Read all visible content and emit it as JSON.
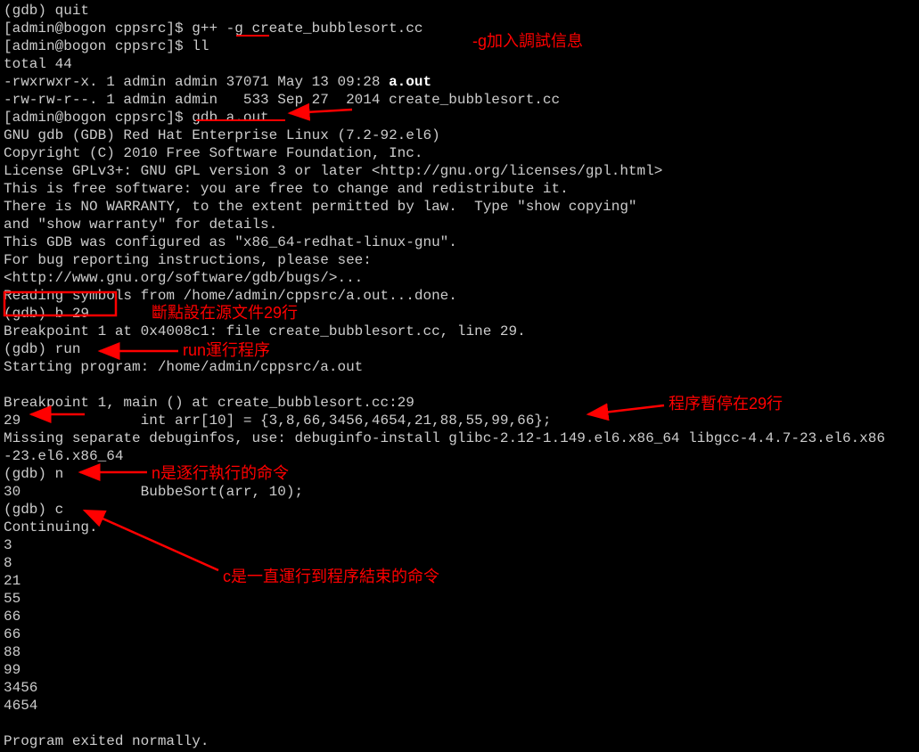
{
  "terminal": {
    "lines": [
      {
        "segments": [
          {
            "t": "(gdb) quit",
            "b": false
          }
        ]
      },
      {
        "segments": [
          {
            "t": "[admin@bogon cppsrc]$ g++ -g create_bubblesort.cc",
            "b": false
          }
        ]
      },
      {
        "segments": [
          {
            "t": "[admin@bogon cppsrc]$ ll",
            "b": false
          }
        ]
      },
      {
        "segments": [
          {
            "t": "total 44",
            "b": false
          }
        ]
      },
      {
        "segments": [
          {
            "t": "-rwxrwxr-x. 1 admin admin 37071 May 13 09:28 ",
            "b": false
          },
          {
            "t": "a.out",
            "b": true
          }
        ]
      },
      {
        "segments": [
          {
            "t": "-rw-rw-r--. 1 admin admin   533 Sep 27  2014 create_bubblesort.cc",
            "b": false
          }
        ]
      },
      {
        "segments": [
          {
            "t": "[admin@bogon cppsrc]$ gdb a.out",
            "b": false
          }
        ]
      },
      {
        "segments": [
          {
            "t": "GNU gdb (GDB) Red Hat Enterprise Linux (7.2-92.el6)",
            "b": false
          }
        ]
      },
      {
        "segments": [
          {
            "t": "Copyright (C) 2010 Free Software Foundation, Inc.",
            "b": false
          }
        ]
      },
      {
        "segments": [
          {
            "t": "License GPLv3+: GNU GPL version 3 or later <http://gnu.org/licenses/gpl.html>",
            "b": false
          }
        ]
      },
      {
        "segments": [
          {
            "t": "This is free software: you are free to change and redistribute it.",
            "b": false
          }
        ]
      },
      {
        "segments": [
          {
            "t": "There is NO WARRANTY, to the extent permitted by law.  Type \"show copying\"",
            "b": false
          }
        ]
      },
      {
        "segments": [
          {
            "t": "and \"show warranty\" for details.",
            "b": false
          }
        ]
      },
      {
        "segments": [
          {
            "t": "This GDB was configured as \"x86_64-redhat-linux-gnu\".",
            "b": false
          }
        ]
      },
      {
        "segments": [
          {
            "t": "For bug reporting instructions, please see:",
            "b": false
          }
        ]
      },
      {
        "segments": [
          {
            "t": "<http://www.gnu.org/software/gdb/bugs/>...",
            "b": false
          }
        ]
      },
      {
        "segments": [
          {
            "t": "Reading symbols from /home/admin/cppsrc/a.out...done.",
            "b": false
          }
        ]
      },
      {
        "segments": [
          {
            "t": "(gdb) b 29",
            "b": false
          }
        ]
      },
      {
        "segments": [
          {
            "t": "Breakpoint 1 at 0x4008c1: file create_bubblesort.cc, line 29.",
            "b": false
          }
        ]
      },
      {
        "segments": [
          {
            "t": "(gdb) run",
            "b": false
          }
        ]
      },
      {
        "segments": [
          {
            "t": "Starting program: /home/admin/cppsrc/a.out",
            "b": false
          }
        ]
      },
      {
        "segments": [
          {
            "t": "",
            "b": false
          }
        ]
      },
      {
        "segments": [
          {
            "t": "Breakpoint 1, main () at create_bubblesort.cc:29",
            "b": false
          }
        ]
      },
      {
        "segments": [
          {
            "t": "29              int arr[10] = {3,8,66,3456,4654,21,88,55,99,66};",
            "b": false
          }
        ]
      },
      {
        "segments": [
          {
            "t": "Missing separate debuginfos, use: debuginfo-install glibc-2.12-1.149.el6.x86_64 libgcc-4.4.7-23.el6.x86",
            "b": false
          }
        ]
      },
      {
        "segments": [
          {
            "t": "-23.el6.x86_64",
            "b": false
          }
        ]
      },
      {
        "segments": [
          {
            "t": "(gdb) n",
            "b": false
          }
        ]
      },
      {
        "segments": [
          {
            "t": "30              BubbeSort(arr, 10);",
            "b": false
          }
        ]
      },
      {
        "segments": [
          {
            "t": "(gdb) c",
            "b": false
          }
        ]
      },
      {
        "segments": [
          {
            "t": "Continuing.",
            "b": false
          }
        ]
      },
      {
        "segments": [
          {
            "t": "3",
            "b": false
          }
        ]
      },
      {
        "segments": [
          {
            "t": "8",
            "b": false
          }
        ]
      },
      {
        "segments": [
          {
            "t": "21",
            "b": false
          }
        ]
      },
      {
        "segments": [
          {
            "t": "55",
            "b": false
          }
        ]
      },
      {
        "segments": [
          {
            "t": "66",
            "b": false
          }
        ]
      },
      {
        "segments": [
          {
            "t": "66",
            "b": false
          }
        ]
      },
      {
        "segments": [
          {
            "t": "88",
            "b": false
          }
        ]
      },
      {
        "segments": [
          {
            "t": "99",
            "b": false
          }
        ]
      },
      {
        "segments": [
          {
            "t": "3456",
            "b": false
          }
        ]
      },
      {
        "segments": [
          {
            "t": "4654",
            "b": false
          }
        ]
      },
      {
        "segments": [
          {
            "t": "",
            "b": false
          }
        ]
      },
      {
        "segments": [
          {
            "t": "Program exited normally.",
            "b": false
          }
        ]
      }
    ]
  },
  "annotations": {
    "a1": "-g加入調試信息",
    "a2": "斷點設在源文件29行",
    "a3": "run運行程序",
    "a4": "程序暫停在29行",
    "a5": "n是逐行執行的命令",
    "a6": "c是一直運行到程序結束的命令"
  },
  "colors": {
    "annotation": "#ff0000",
    "bg": "#000000",
    "fg": "#cccccc",
    "bold": "#ffffff"
  }
}
